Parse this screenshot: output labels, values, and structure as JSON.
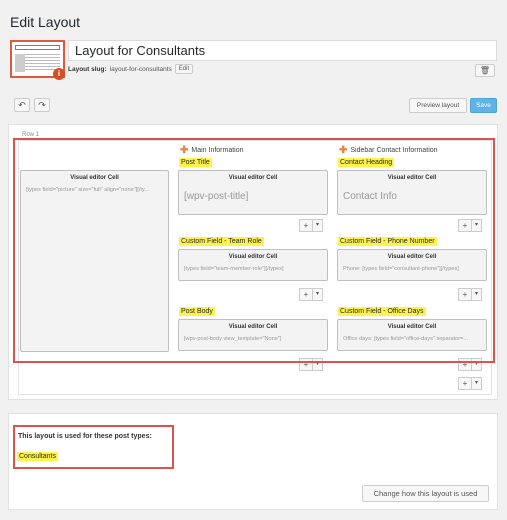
{
  "header": {
    "title": "Edit Layout",
    "layout_name": "Layout for Consultants",
    "slug_label": "Layout slug:",
    "slug_value": "layout-for-consultants",
    "edit_label": "Edit"
  },
  "toolbar": {
    "undo_icon": "↶",
    "redo_icon": "↷",
    "preview_label": "Preview layout",
    "save_label": "Save",
    "trash_icon": "🗑"
  },
  "grid": {
    "row_label": "Row 1",
    "columns": [
      {
        "heading": "Main Information"
      },
      {
        "heading": "Sidebar Contact Information"
      }
    ],
    "cells": [
      {
        "field": "",
        "title": "Visual editor Cell",
        "content": "[types field=\"picture\" size=\"full\" align=\"none\"][/ty..."
      },
      {
        "field": "Post Title",
        "title": "Visual editor Cell",
        "content": "[wpv-post-title]"
      },
      {
        "field": "Contact Heading",
        "title": "Visual editor Cell",
        "content": "Contact Info"
      },
      {
        "field": "Custom Field - Team Role",
        "title": "Visual editor Cell",
        "content": "[types field=\"team-member-role\"][/types]"
      },
      {
        "field": "Custom Field - Phone Number",
        "title": "Visual editor Cell",
        "content": "Phone: [types field=\"consultant-phone\"][/types]"
      },
      {
        "field": "Post Body",
        "title": "Visual editor Cell",
        "content": "[wpv-post-body view_template=\"None\"]"
      },
      {
        "field": "Custom Field - Office Days",
        "title": "Visual editor Cell",
        "content": "Office days: [types field=\"office-days\" separator=..."
      }
    ],
    "add_icon": "+",
    "dropdown_icon": "▾"
  },
  "bottom": {
    "used_for_label": "This layout is used for these post types:",
    "post_type": "Consultants",
    "change_button": "Change how this layout is used"
  },
  "colors": {
    "highlight": "#fff24a",
    "annotation_red": "#d9534f",
    "save_blue": "#5fb4e6",
    "drag_orange": "#e08a4a"
  }
}
